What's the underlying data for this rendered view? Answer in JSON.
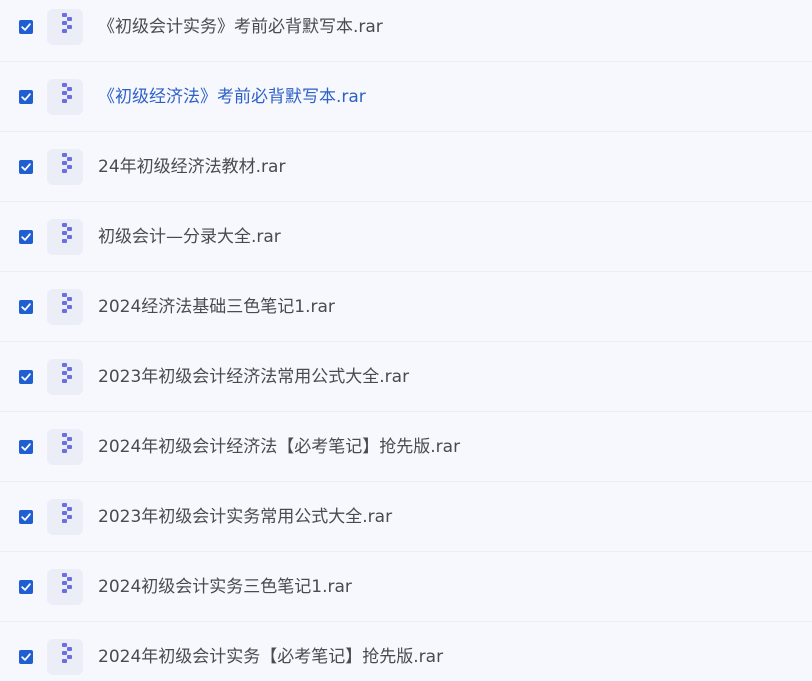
{
  "file_list": {
    "files": [
      {
        "name": "《初级会计实务》考前必背默写本.rar",
        "checked": true,
        "icon": "zip-archive-icon"
      },
      {
        "name": "《初级经济法》考前必背默写本.rar",
        "checked": true,
        "icon": "zip-archive-icon",
        "state": "hovered"
      },
      {
        "name": "24年初级经济法教材.rar",
        "checked": true,
        "icon": "zip-archive-icon"
      },
      {
        "name": "初级会计—分录大全.rar",
        "checked": true,
        "icon": "zip-archive-icon"
      },
      {
        "name": "2024经济法基础三色笔记1.rar",
        "checked": true,
        "icon": "zip-archive-icon"
      },
      {
        "name": "2023年初级会计经济法常用公式大全.rar",
        "checked": true,
        "icon": "zip-archive-icon"
      },
      {
        "name": "2024年初级会计经济法【必考笔记】抢先版.rar",
        "checked": true,
        "icon": "zip-archive-icon"
      },
      {
        "name": "2023年初级会计实务常用公式大全.rar",
        "checked": true,
        "icon": "zip-archive-icon"
      },
      {
        "name": "2024初级会计实务三色笔记1.rar",
        "checked": true,
        "icon": "zip-archive-icon"
      },
      {
        "name": "2024年初级会计实务【必考笔记】抢先版.rar",
        "checked": true,
        "icon": "zip-archive-icon"
      }
    ]
  },
  "colors": {
    "background": "#f6f8fe",
    "checkbox_fill": "#1f5fd2",
    "icon_tile": "#eceef7",
    "icon_zipper": "#6b6fe6",
    "filename_text": "#4a4a4f",
    "filename_hover_text": "#2e61c7"
  }
}
